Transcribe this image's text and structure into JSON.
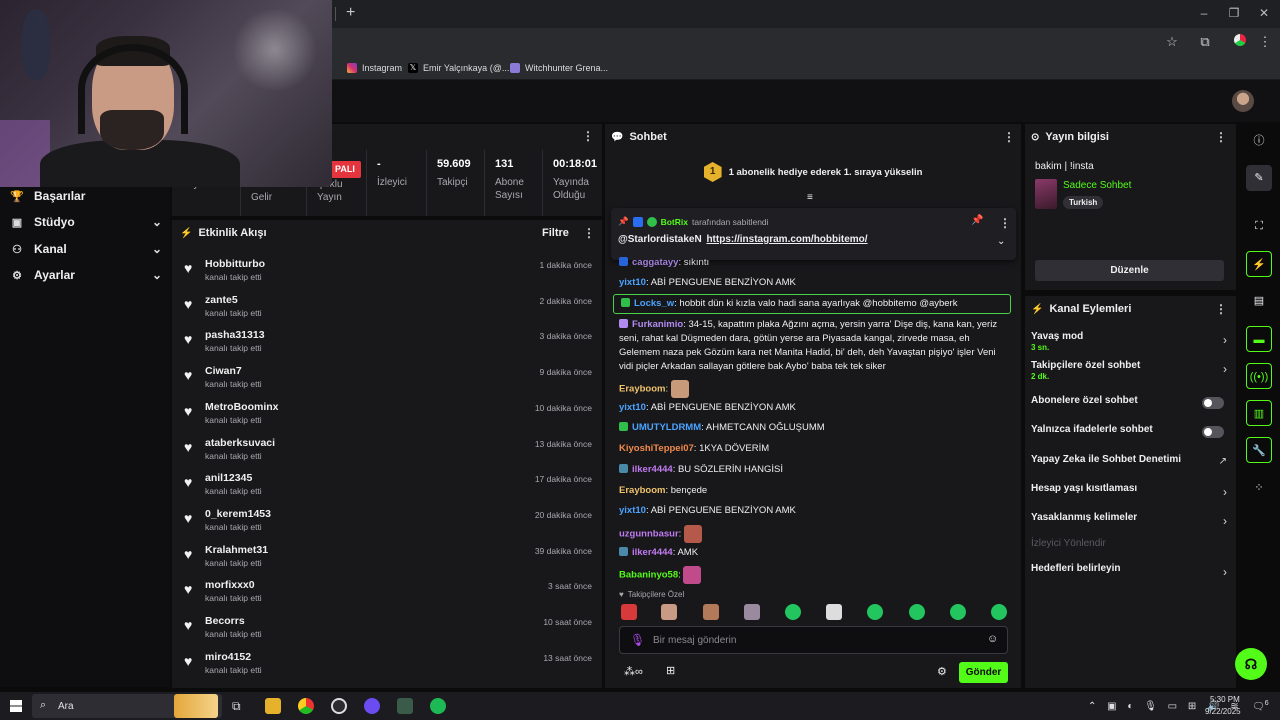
{
  "bookmarks": [
    {
      "label": "Instagram",
      "color": "#d6306e"
    },
    {
      "label": "Emir Yalçınkaya (@...",
      "color": "#ffffff"
    },
    {
      "label": "Witchhunter Grena...",
      "color": "#8c7bd6"
    }
  ],
  "stats": {
    "live_badge": "PALI",
    "partial_labels": [
      "Yayın",
      "Partnerlik Gelir",
      "Çoklu Yayın"
    ],
    "viewers": {
      "value": "-",
      "label": "İzleyici"
    },
    "followers": {
      "value": "59.609",
      "label": "Takipçi"
    },
    "subs": {
      "value": "131",
      "label": "Abone Sayısı"
    },
    "uptime": {
      "value": "00:18:01",
      "label": "Yayında Olduğu Süre"
    }
  },
  "nav": [
    {
      "label": "Başarılar",
      "icon": "trophy-icon"
    },
    {
      "label": "Stüdyo",
      "icon": "studio-icon"
    },
    {
      "label": "Kanal",
      "icon": "users-icon"
    },
    {
      "label": "Ayarlar",
      "icon": "gear-icon"
    }
  ],
  "activity": {
    "title": "Etkinlik Akışı",
    "filter": "Filtre",
    "items": [
      {
        "name": "Hobbitturbo",
        "sub": "kanalı takip etti",
        "time": "1 dakika önce"
      },
      {
        "name": "zante5",
        "sub": "kanalı takip etti",
        "time": "2 dakika önce"
      },
      {
        "name": "pasha31313",
        "sub": "kanalı takip etti",
        "time": "3 dakika önce"
      },
      {
        "name": "Ciwan7",
        "sub": "kanalı takip etti",
        "time": "9 dakika önce"
      },
      {
        "name": "MetroBoominx",
        "sub": "kanalı takip etti",
        "time": "10 dakika önce"
      },
      {
        "name": "ataberksuvaci",
        "sub": "kanalı takip etti",
        "time": "13 dakika önce"
      },
      {
        "name": "anil12345",
        "sub": "kanalı takip etti",
        "time": "17 dakika önce"
      },
      {
        "name": "0_kerem1453",
        "sub": "kanalı takip etti",
        "time": "20 dakika önce"
      },
      {
        "name": "Kralahmet31",
        "sub": "kanalı takip etti",
        "time": "39 dakika önce"
      },
      {
        "name": "morfixxx0",
        "sub": "kanalı takip etti",
        "time": "3 saat önce"
      },
      {
        "name": "Becorrs",
        "sub": "kanalı takip etti",
        "time": "10 saat önce"
      },
      {
        "name": "miro4152",
        "sub": "kanalı takip etti",
        "time": "13 saat önce"
      }
    ]
  },
  "chat": {
    "title": "Sohbet",
    "sub_banner": "1 abonelik hediye ederek 1. sıraya yükselin",
    "sub_rank": "1",
    "pinned_by_user": "BotRix",
    "pinned_by_text": "tarafından sabitlendi",
    "pinned_user": "@StarlordistakeN",
    "pinned_link": "https://instagram.com/hobbitemo/",
    "messages": [
      {
        "user": "caggatayy",
        "text": "sıkıntı",
        "color": "#b18cf0"
      },
      {
        "user": "yixt10",
        "text": "ABİ PENGUENE BENZİYON AMK",
        "color": "#4aa3ff"
      },
      {
        "user": "Locks_w",
        "text": "hobbit dün ki kızla valo hadi sana ayarlıyak @hobbitemo @ayberk",
        "color": "#4aa3ff"
      },
      {
        "user": "Furkanimio",
        "text": "34-15, kapattım plaka Ağzını açma, yersin yarra' Dişe diş, kana kan, yeriz seni, rahat kal Düşmeden dara, götün yerse ara Piyasada kangal, zirvede masa, eh Gelemem naza pek Gözüm kara net Manita Hadid, bi' deh, deh Yavaştan pişiyo' işler Veni vidi piçler Arkadan sallayan götlere bak Aybo' baba tek tek siker",
        "color": "#b18cf0"
      },
      {
        "user": "Erayboom",
        "text": "",
        "color": "#f0c36b"
      },
      {
        "user": "yixt10",
        "text": "ABİ PENGUENE BENZİYON AMK",
        "color": "#4aa3ff"
      },
      {
        "user": "UMUTYLDRMM",
        "text": "AHMETCANN OĞLUŞUMM",
        "color": "#4aa3ff"
      },
      {
        "user": "KiyoshiTeppei07",
        "text": "1KYA DÖVERİM",
        "color": "#f08a4b"
      },
      {
        "user": "ilker4444",
        "text": "BU SÖZLERİN HANGİSİ",
        "color": "#c07af0"
      },
      {
        "user": "Erayboom",
        "text": "bençede",
        "color": "#f0c36b"
      },
      {
        "user": "yixt10",
        "text": "ABİ PENGUENE BENZİYON AMK",
        "color": "#4aa3ff"
      },
      {
        "user": "uzgunnbasur",
        "text": "",
        "color": "#c07af0"
      },
      {
        "user": "ilker4444",
        "text": "AMK",
        "color": "#c07af0"
      },
      {
        "user": "Babaninyo58",
        "text": "",
        "color": "#53fc18"
      }
    ],
    "emote_label": "Takipçilere Özel",
    "input_placeholder": "Bir mesaj gönderin",
    "send": "Gönder"
  },
  "stream_info": {
    "title": "Yayın bilgisi",
    "stream_title": "bakim | !insta",
    "category": "Sadece Sohbet",
    "tag": "Turkish",
    "edit": "Düzenle"
  },
  "channel_actions": {
    "title": "Kanal Eylemleri",
    "rows": [
      {
        "label": "Yavaş mod",
        "sub": "3 sn.",
        "kind": "chevron"
      },
      {
        "label": "Takipçilere özel sohbet",
        "sub": "2 dk.",
        "kind": "chevron"
      },
      {
        "label": "Abonelere özel sohbet",
        "sub": "",
        "kind": "toggle"
      },
      {
        "label": "Yalnızca ifadelerle sohbet",
        "sub": "",
        "kind": "toggle"
      },
      {
        "label": "Yapay Zeka ile Sohbet Denetimi",
        "sub": "",
        "kind": "external"
      },
      {
        "label": "Hesap yaşı kısıtlaması",
        "sub": "",
        "kind": "chevron"
      },
      {
        "label": "Yasaklanmış kelimeler",
        "sub": "",
        "kind": "chevron"
      },
      {
        "label": "İzleyici Yönlendir",
        "sub": "",
        "kind": "disabled"
      },
      {
        "label": "Hedefleri belirleyin",
        "sub": "",
        "kind": "chevron"
      }
    ]
  },
  "taskbar": {
    "search": "Ara",
    "time": "5:30 PM",
    "date": "9/22/2025",
    "notifications": "6"
  }
}
